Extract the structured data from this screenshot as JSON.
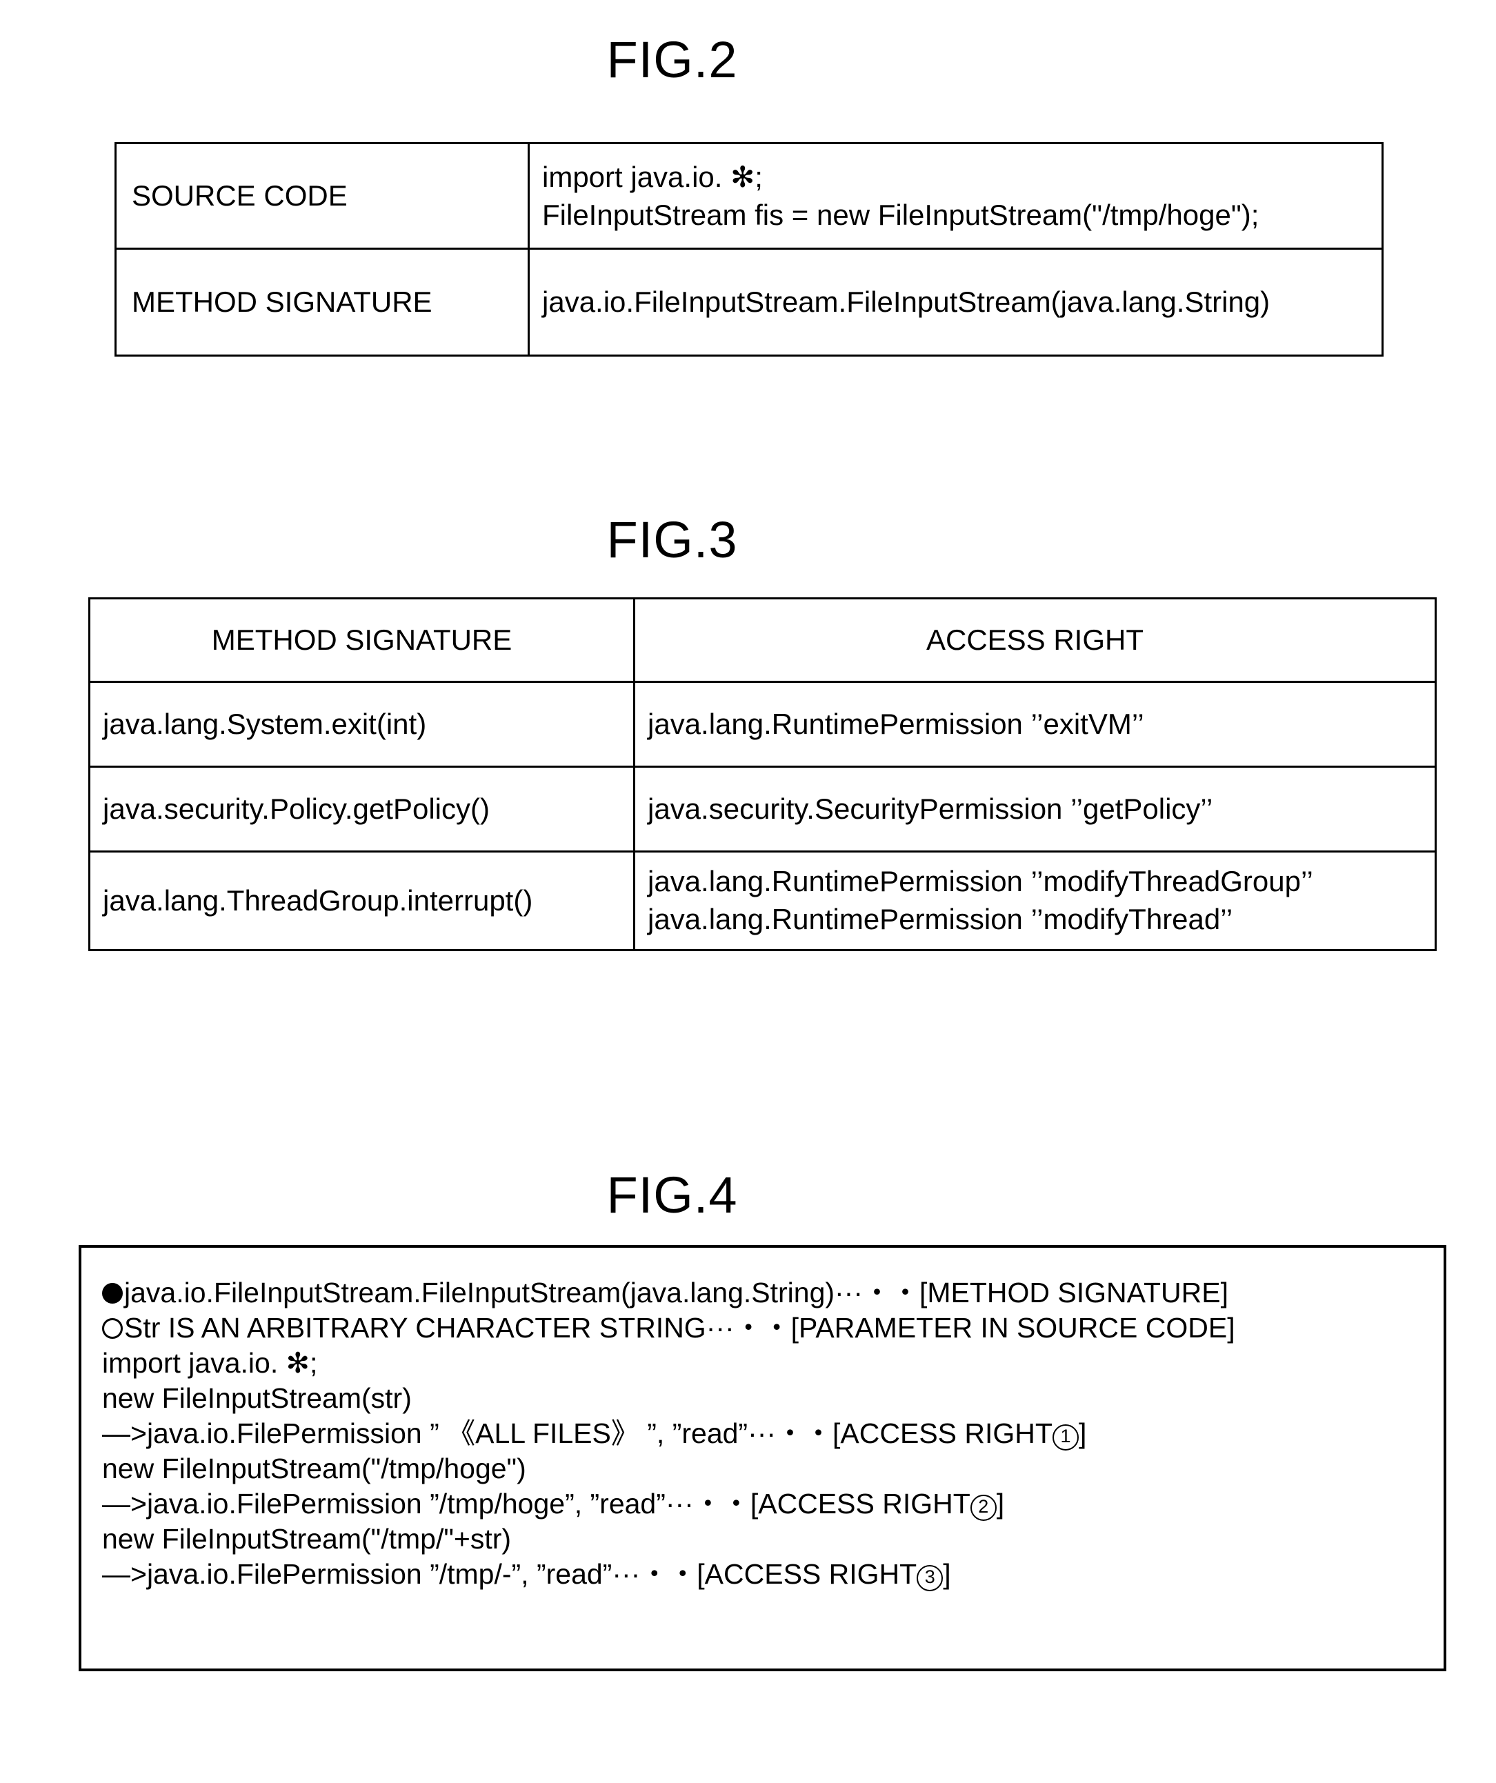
{
  "figures": {
    "fig2": {
      "title": "FIG.2",
      "rows": [
        {
          "label": "SOURCE CODE",
          "lines": [
            "import java.io. ✻;",
            "FileInputStream fis = new FileInputStream(\"/tmp/hoge\");"
          ]
        },
        {
          "label": "METHOD SIGNATURE",
          "lines": [
            "java.io.FileInputStream.FileInputStream(java.lang.String)"
          ]
        }
      ]
    },
    "fig3": {
      "title": "FIG.3",
      "headers": [
        "METHOD SIGNATURE",
        "ACCESS RIGHT"
      ],
      "rows": [
        {
          "method_signature": "java.lang.System.exit(int)",
          "access_right_lines": [
            "java.lang.RuntimePermission ’’exitVM’’"
          ]
        },
        {
          "method_signature": "java.security.Policy.getPolicy()",
          "access_right_lines": [
            "java.security.SecurityPermission ’’getPolicy’’"
          ]
        },
        {
          "method_signature": "java.lang.ThreadGroup.interrupt()",
          "access_right_lines": [
            "java.lang.RuntimePermission ’’modifyThreadGroup’’",
            "java.lang.RuntimePermission ’’modifyThread’’"
          ]
        }
      ]
    },
    "fig4": {
      "title": "FIG.4",
      "lines": [
        {
          "marker": "filled-circle",
          "text": "java.io.FileInputStream.FileInputStream(java.lang.String)···・・[METHOD SIGNATURE]"
        },
        {
          "marker": "hollow-circle",
          "text": "Str IS AN ARBITRARY CHARACTER STRING···・・[PARAMETER IN SOURCE CODE]"
        },
        {
          "marker": "none",
          "text": "import java.io. ✻;"
        },
        {
          "marker": "none",
          "text": "new FileInputStream(str)"
        },
        {
          "marker": "none",
          "text": "—>java.io.FilePermission ” 《ALL FILES》 ”, ”read”···・・[ACCESS RIGHT",
          "circled": "1",
          "tail": "]"
        },
        {
          "marker": "none",
          "text": "new FileInputStream(\"/tmp/hoge\")"
        },
        {
          "marker": "none",
          "text": "—>java.io.FilePermission ”/tmp/hoge”, ”read”···・・[ACCESS RIGHT",
          "circled": "2",
          "tail": "]"
        },
        {
          "marker": "none",
          "text": "new FileInputStream(\"/tmp/\"+str)"
        },
        {
          "marker": "none",
          "text": "—>java.io.FilePermission ”/tmp/-”, ”read”···・・[ACCESS RIGHT",
          "circled": "3",
          "tail": "]"
        }
      ]
    }
  },
  "colors": {
    "ink": "#000000",
    "paper": "#ffffff"
  }
}
